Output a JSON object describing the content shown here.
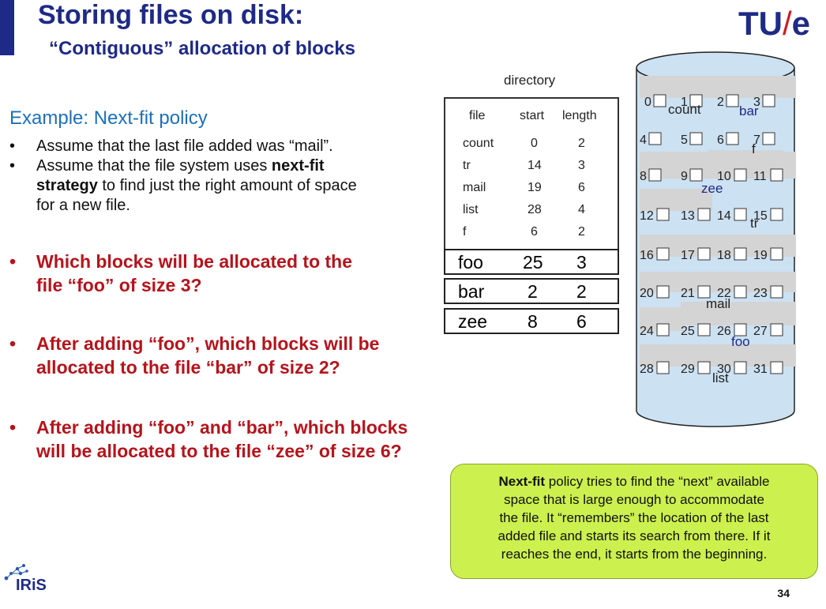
{
  "slide": {
    "title": "Storing files on disk:",
    "subtitle": "“Contiguous” allocation of blocks",
    "logo": "TU/e",
    "page_number": "34",
    "brand_logo": "IRiS"
  },
  "example": {
    "heading": "Example: Next-fit policy",
    "bullets": [
      [
        "Assume that the last file added was “mail”."
      ],
      [
        "Assume that the file system uses ",
        "next-fit",
        "strategy",
        " to find just the right amount of space",
        "for a new file."
      ]
    ],
    "questions": [
      [
        "Which blocks will be allocated to the",
        "file “foo” of size 3?"
      ],
      [
        "After adding “foo”, which blocks will be",
        "allocated to the file “bar” of size 2?"
      ],
      [
        "After adding “foo” and “bar”, which blocks",
        "will be allocated to the file “zee” of size 6?"
      ]
    ]
  },
  "directory": {
    "label": "directory",
    "headers": [
      "file",
      "start",
      "length"
    ],
    "rows": [
      [
        "count",
        "0",
        "2"
      ],
      [
        "tr",
        "14",
        "3"
      ],
      [
        "mail",
        "19",
        "6"
      ],
      [
        "list",
        "28",
        "4"
      ],
      [
        "f",
        "6",
        "2"
      ]
    ],
    "added": [
      [
        "foo",
        "25",
        "3"
      ],
      [
        "bar",
        "2",
        "2"
      ],
      [
        "zee",
        "8",
        "6"
      ]
    ]
  },
  "disk": {
    "blocks": [
      "0",
      "1",
      "2",
      "3",
      "4",
      "5",
      "6",
      "7",
      "8",
      "9",
      "10",
      "11",
      "12",
      "13",
      "14",
      "15",
      "16",
      "17",
      "18",
      "19",
      "20",
      "21",
      "22",
      "23",
      "24",
      "25",
      "26",
      "27",
      "28",
      "29",
      "30",
      "31"
    ],
    "labels": [
      "count",
      "bar",
      "f",
      "zee",
      "tr",
      "mail",
      "foo",
      "list"
    ],
    "colors": {
      "disk_fill": "#cce1f2",
      "shade": "#d4d4d4",
      "label_blue": "#1e2a86"
    }
  },
  "note": {
    "bold": "Next-fit",
    "lines": [
      " policy tries to find the “next” available",
      "space that is large enough to accommodate",
      "the file. It “remembers” the location of the last",
      "added file and starts its search from there. If it",
      "reaches the end, it starts from the beginning."
    ]
  }
}
